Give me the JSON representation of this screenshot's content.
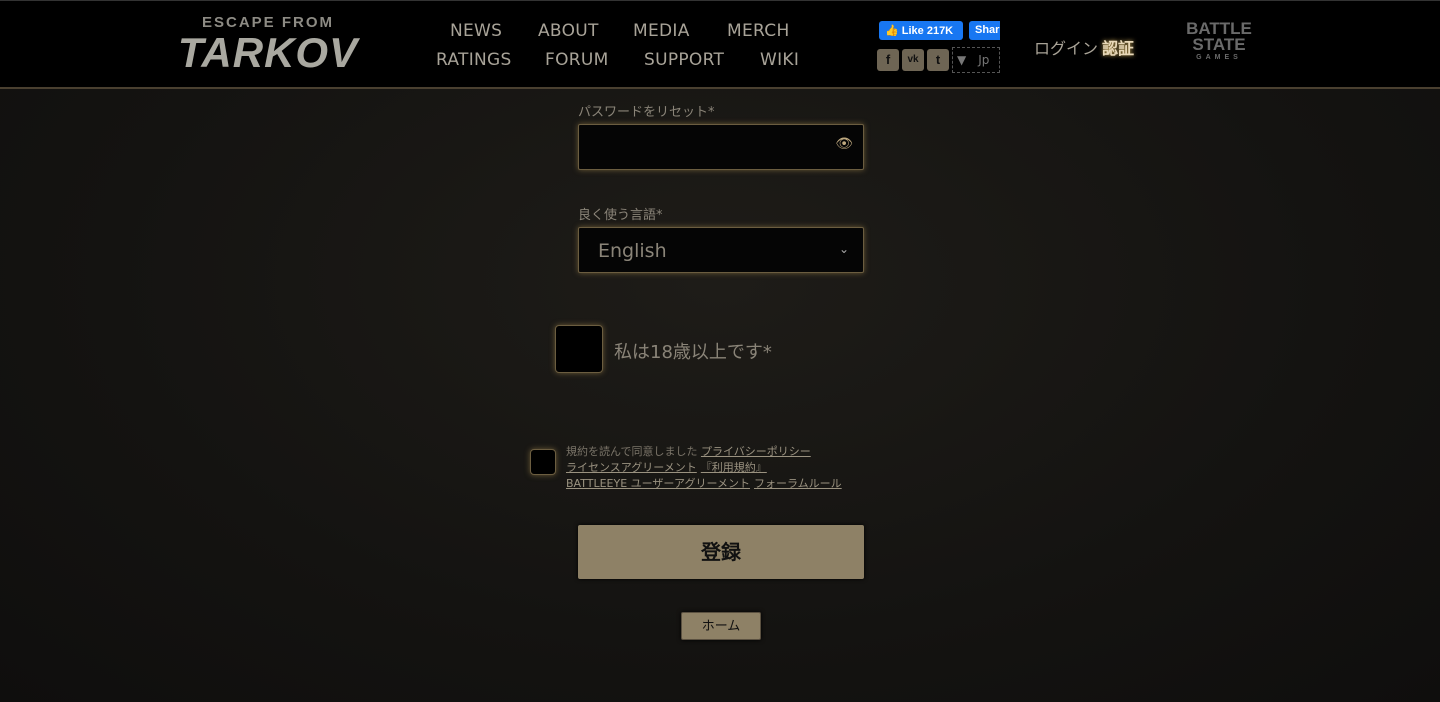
{
  "header": {
    "logo": {
      "top": "ESCAPE FROM",
      "big": "TARKOV"
    },
    "nav": [
      {
        "label": "NEWS"
      },
      {
        "label": "ABOUT"
      },
      {
        "label": "MEDIA"
      },
      {
        "label": "MERCH"
      },
      {
        "label": "RATINGS"
      },
      {
        "label": "FORUM"
      },
      {
        "label": "SUPPORT"
      },
      {
        "label": "WIKI"
      }
    ],
    "facebook": {
      "like": "Like 217K",
      "share": "Share"
    },
    "social": [
      {
        "icon": "facebook-icon",
        "glyph": "f"
      },
      {
        "icon": "vk-icon",
        "glyph": "vk"
      },
      {
        "icon": "twitter-icon",
        "glyph": "t"
      }
    ],
    "language": {
      "arrow": "▼",
      "value": "Jp"
    },
    "login": "ログイン",
    "verify": "認証",
    "bsg_logo": {
      "line1": "BATTLE",
      "line2": "STATE",
      "line3": "GAMES"
    }
  },
  "form": {
    "password_label": "パスワードをリセット*",
    "password_value": "",
    "language_label": "良く使う言語*",
    "language_value": "English",
    "age_label": "私は18歳以上です*",
    "terms_prefix": "規約を読んで同意しました",
    "terms_links": [
      "プライバシーポリシー",
      "ライセンスアグリーメント",
      "『利用規約』",
      "BATTLEEYE ユーザーアグリーメント",
      "フォーラムルール"
    ],
    "register_button": "登録",
    "home_button": "ホーム"
  },
  "colors": {
    "accent": "#8e8166",
    "background": "#141311"
  }
}
